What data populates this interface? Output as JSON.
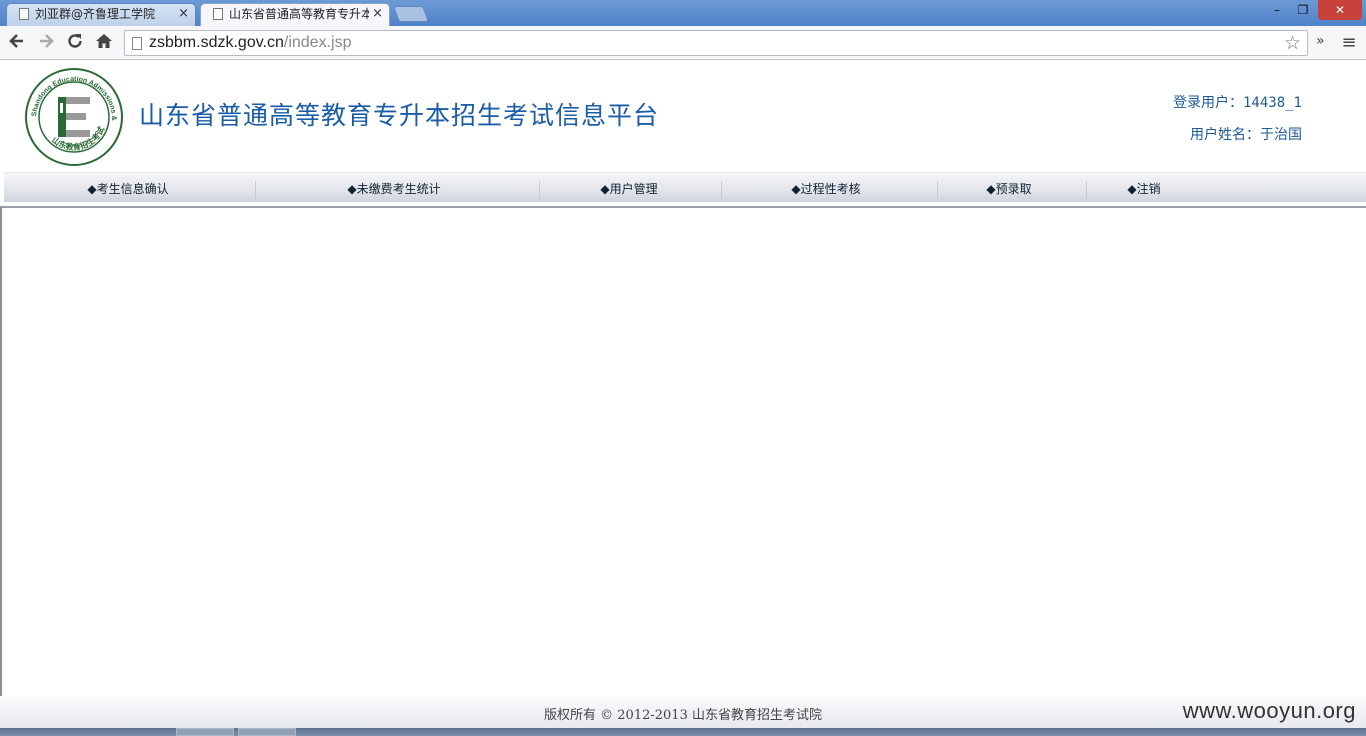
{
  "browser": {
    "tabs": [
      {
        "title": "刘亚群@齐鲁理工学院",
        "active": false
      },
      {
        "title": "山东省普通高等教育专升本",
        "active": true
      }
    ],
    "close_glyph": "×",
    "url_host": "zsbbm.sdzk.gov.cn",
    "url_path": "/index.jsp",
    "window_controls": {
      "minimize": "–",
      "maximize": "❐",
      "close": "✕"
    },
    "nav_icons": {
      "back": "back-arrow-icon",
      "forward": "forward-arrow-icon",
      "reload": "reload-icon",
      "home": "home-icon",
      "star": "star-icon",
      "menu": "menu-icon"
    }
  },
  "header": {
    "logo": {
      "ring_text_top": "Shandong Education Admissions & Examinations",
      "ring_text_bottom": "山东教育招生考试",
      "letter": "E"
    },
    "title": "山东省普通高等教育专升本招生考试信息平台",
    "login_user_label": "登录用户：",
    "login_user_value": "14438_1",
    "user_name_label": "用户姓名：",
    "user_name_value": "于治国"
  },
  "nav": {
    "items": [
      {
        "label": "◆考生信息确认"
      },
      {
        "label": "◆未缴费考生统计"
      },
      {
        "label": "◆用户管理"
      },
      {
        "label": "◆过程性考核"
      },
      {
        "label": "◆预录取"
      },
      {
        "label": "◆注销"
      }
    ]
  },
  "footer": {
    "copyright": "版权所有 © 2012-2013 山东省教育招生考试院"
  },
  "watermark": "www.wooyun.org",
  "colors": {
    "title_blue": "#1a5ca8",
    "user_info_blue": "#1e5a94",
    "logo_green": "#2a6a36",
    "close_red": "#c8423b"
  }
}
